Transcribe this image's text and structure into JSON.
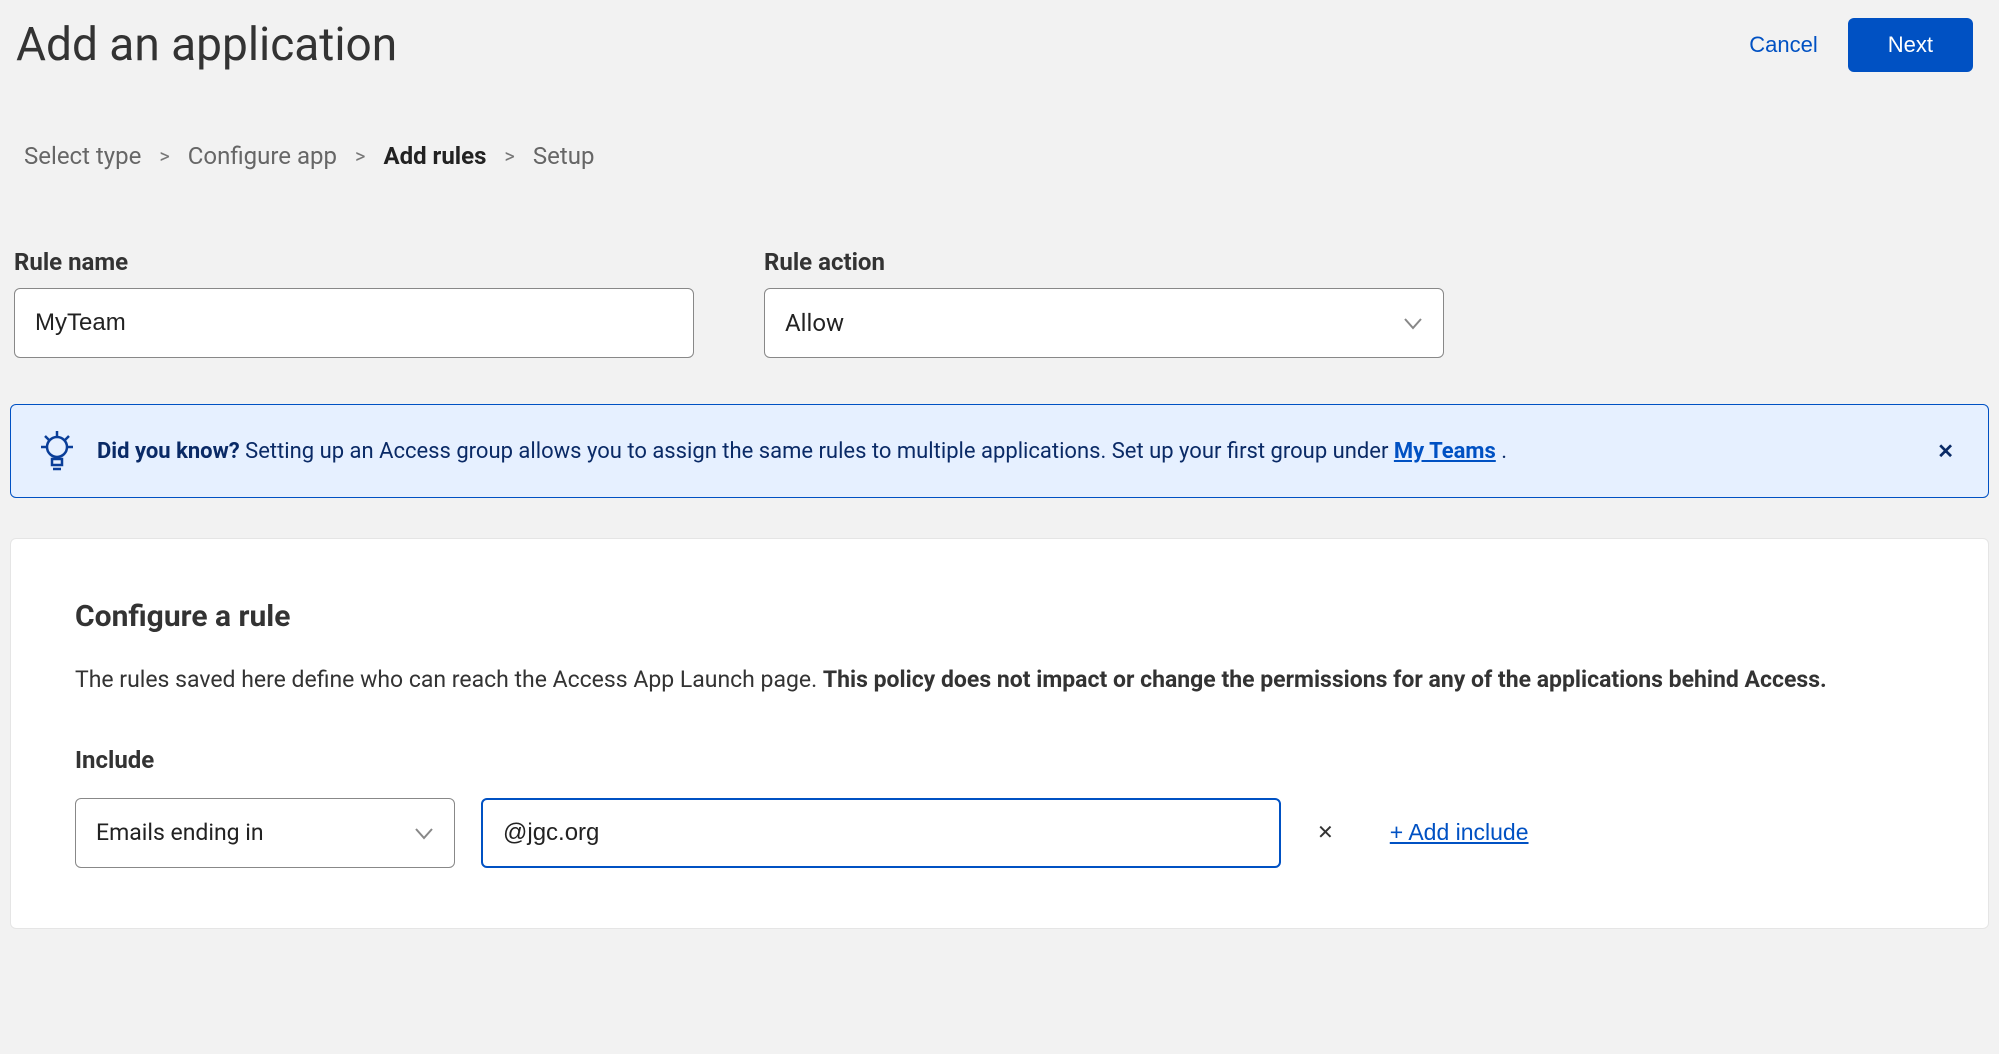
{
  "header": {
    "title": "Add an application",
    "cancel_label": "Cancel",
    "next_label": "Next"
  },
  "wizard": {
    "steps": [
      "Select type",
      "Configure app",
      "Add rules",
      "Setup"
    ],
    "active_index": 2
  },
  "fields": {
    "rule_name_label": "Rule name",
    "rule_name_value": "MyTeam",
    "rule_action_label": "Rule action",
    "rule_action_value": "Allow"
  },
  "banner": {
    "lead": "Did you know?",
    "body": " Setting up an Access group allows you to assign the same rules to multiple applications. Set up your first group under ",
    "link_label": "My Teams",
    "trailing": " ."
  },
  "panel": {
    "title": "Configure a rule",
    "desc_prefix": "The rules saved here define who can reach the Access App Launch page. ",
    "desc_bold": "This policy does not impact or change the permissions for any of the applications behind Access.",
    "include_label": "Include",
    "include_selector_value": "Emails ending in",
    "include_input_value": "@jgc.org",
    "add_include_label": "+ Add include"
  }
}
